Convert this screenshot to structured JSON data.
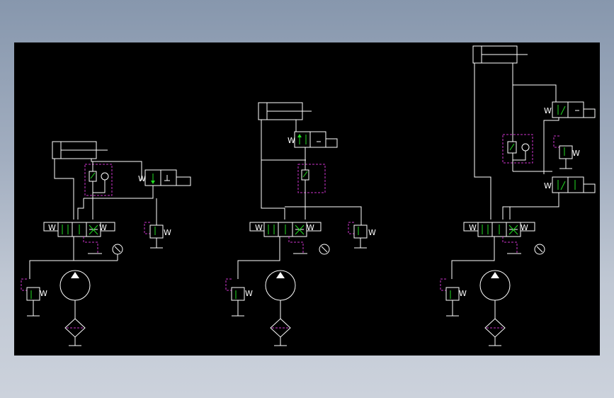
{
  "colors": {
    "canvas": "#000000",
    "line": "#ffffff",
    "spool_arrow": "#22dd22",
    "pilot_dashed": "#cc33cc",
    "backdrop_top": "#8797ad",
    "backdrop_bottom": "#ccd2dc"
  },
  "spring_label": "W",
  "circuits": [
    {
      "id": "circuit-1"
    },
    {
      "id": "circuit-2"
    },
    {
      "id": "circuit-3"
    }
  ]
}
